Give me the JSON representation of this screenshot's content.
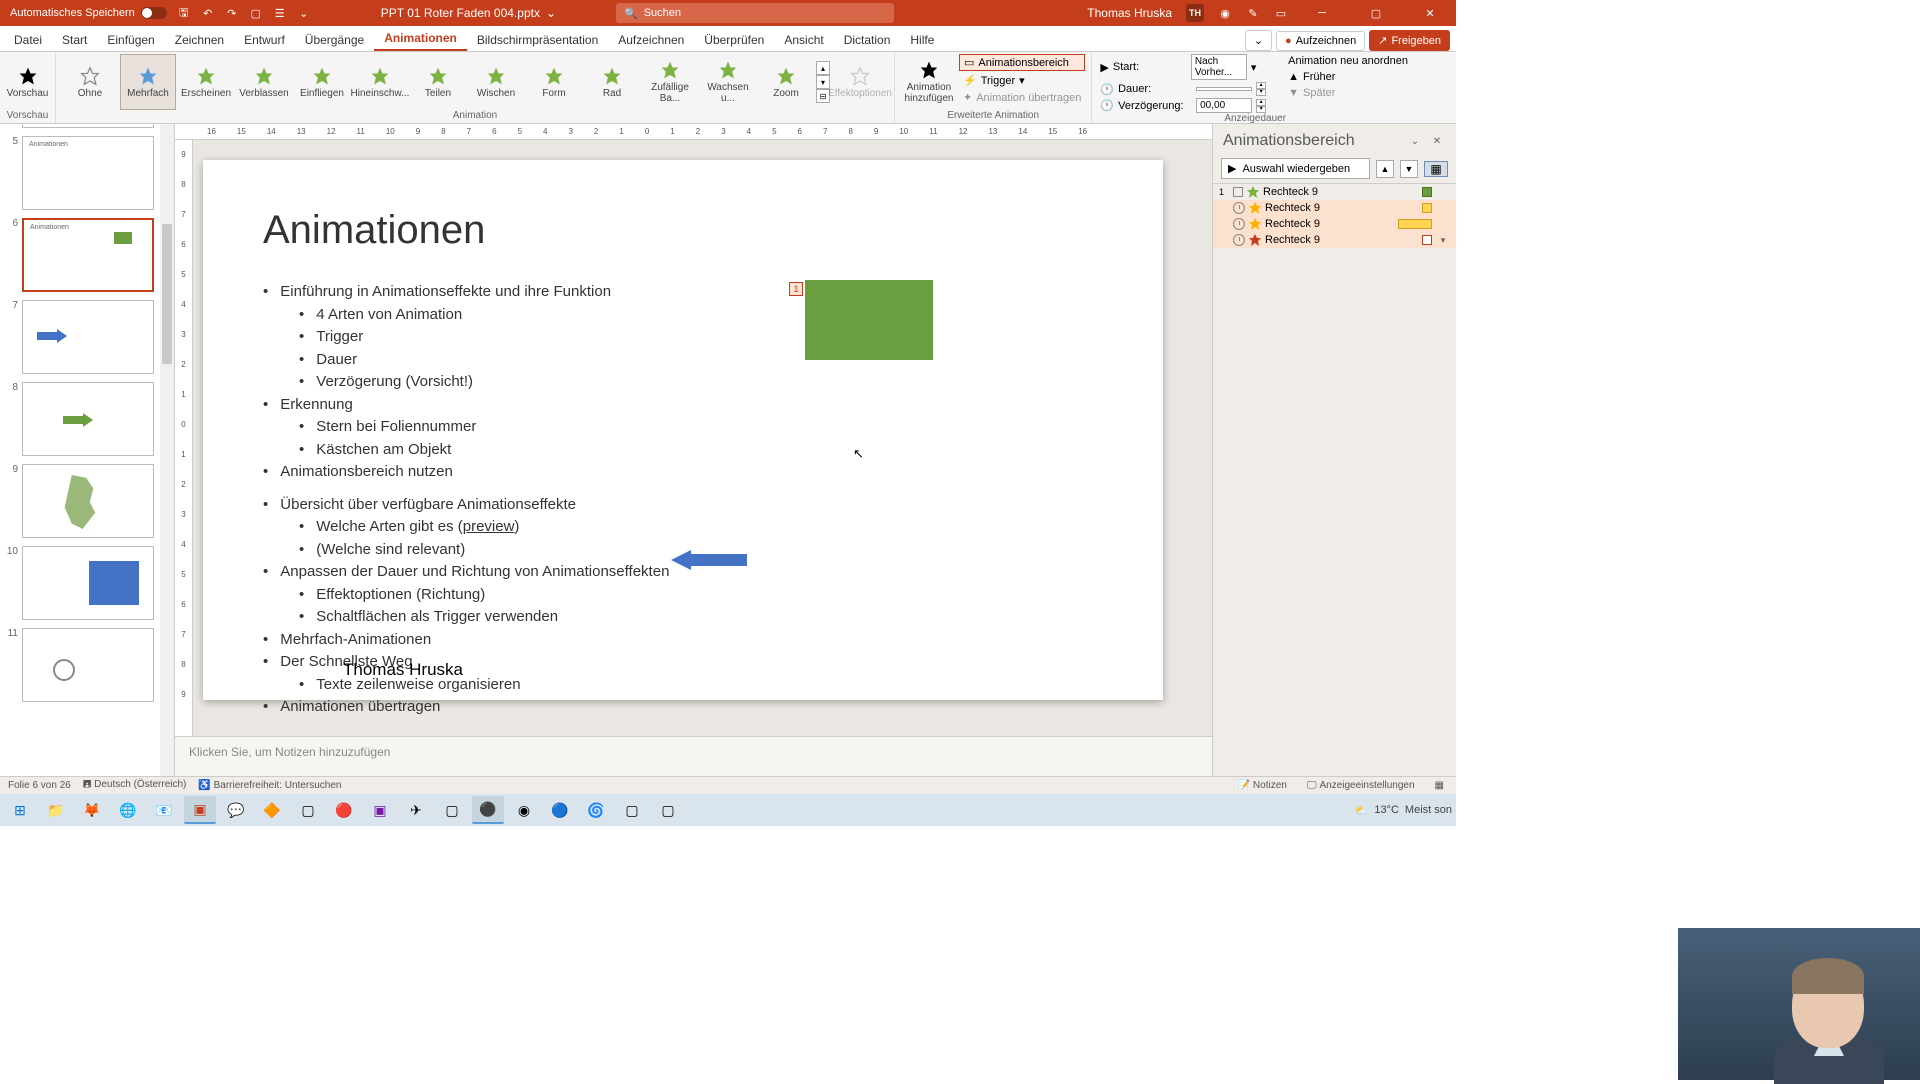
{
  "titlebar": {
    "autosave": "Automatisches Speichern",
    "filename": "PPT 01 Roter Faden 004.pptx",
    "search_placeholder": "Suchen",
    "user": "Thomas Hruska",
    "user_initials": "TH"
  },
  "tabs": {
    "datei": "Datei",
    "start": "Start",
    "einfuegen": "Einfügen",
    "zeichnen": "Zeichnen",
    "entwurf": "Entwurf",
    "uebergaenge": "Übergänge",
    "animationen": "Animationen",
    "bildschirm": "Bildschirmpräsentation",
    "aufzeichnen_tab": "Aufzeichnen",
    "ueberpruefen": "Überprüfen",
    "ansicht": "Ansicht",
    "dictation": "Dictation",
    "hilfe": "Hilfe",
    "aufzeichnen_btn": "Aufzeichnen",
    "freigeben": "Freigeben"
  },
  "ribbon": {
    "vorschau": "Vorschau",
    "vorschau_grp": "Vorschau",
    "anim": {
      "ohne": "Ohne",
      "mehrfach": "Mehrfach",
      "erscheinen": "Erscheinen",
      "verblassen": "Verblassen",
      "einfliegen": "Einfliegen",
      "hineinschw": "Hineinschw...",
      "teilen": "Teilen",
      "wischen": "Wischen",
      "form": "Form",
      "rad": "Rad",
      "zufaellige": "Zufällige Ba...",
      "wachsen": "Wachsen u...",
      "zoom": "Zoom"
    },
    "animation_grp": "Animation",
    "effektoptionen": "Effektoptionen",
    "anim_hinzu": "Animation hinzufügen",
    "animationsbereich": "Animationsbereich",
    "trigger": "Trigger",
    "anim_uebertragen": "Animation übertragen",
    "erweiterte_grp": "Erweiterte Animation",
    "start_lbl": "Start:",
    "start_val": "Nach Vorher...",
    "dauer_lbl": "Dauer:",
    "dauer_val": "",
    "verz_lbl": "Verzögerung:",
    "verz_val": "00,00",
    "neu_anordnen": "Animation neu anordnen",
    "frueher": "Früher",
    "spaeter": "Später",
    "anzeigedauer_grp": "Anzeigedauer"
  },
  "thumbs": {
    "n5": "5",
    "t5": "Animationen",
    "n6": "6",
    "t6": "Animationen",
    "n7": "7",
    "n8": "8",
    "n9": "9",
    "n10": "10",
    "n11": "11"
  },
  "slide": {
    "title": "Animationen",
    "b1": "Einführung in Animationseffekte und ihre Funktion",
    "b1a": "4 Arten von Animation",
    "b1b": "Trigger",
    "b1c": "Dauer",
    "b1d": "Verzögerung (Vorsicht!)",
    "b2": "Erkennung",
    "b2a": "Stern bei Foliennummer",
    "b2b": "Kästchen am Objekt",
    "b3": "Animationsbereich nutzen",
    "b4": "Übersicht über verfügbare Animationseffekte",
    "b4a_pre": "Welche Arten gibt es (",
    "b4a_link": "preview",
    "b4a_post": ")",
    "b4b": "(Welche sind relevant)",
    "b5": "Anpassen der Dauer und Richtung von Animationseffekten",
    "b5a": "Effektoptionen (Richtung)",
    "b5b": "Schaltflächen als Trigger verwenden",
    "b6": "Mehrfach-Animationen",
    "b7": "Der Schnellste Weg",
    "b7a": "Texte zeilenweise organisieren",
    "b8": "Animationen übertragen",
    "author": "Thomas Hruska",
    "tag": "1"
  },
  "notes": "Klicken Sie, um Notizen hinzuzufügen",
  "animpane": {
    "title": "Animationsbereich",
    "play": "Auswahl wiedergeben",
    "rows": {
      "r1_idx": "1",
      "r1": "Rechteck 9",
      "r2": "Rechteck 9",
      "r3": "Rechteck 9",
      "r4": "Rechteck 9"
    }
  },
  "status": {
    "folie": "Folie 6 von 26",
    "lang": "Deutsch (Österreich)",
    "access": "Barrierefreiheit: Untersuchen",
    "notizen": "Notizen",
    "anzeige": "Anzeigeeinstellungen"
  },
  "taskbar": {
    "temp": "13°C",
    "weather": "Meist son"
  }
}
